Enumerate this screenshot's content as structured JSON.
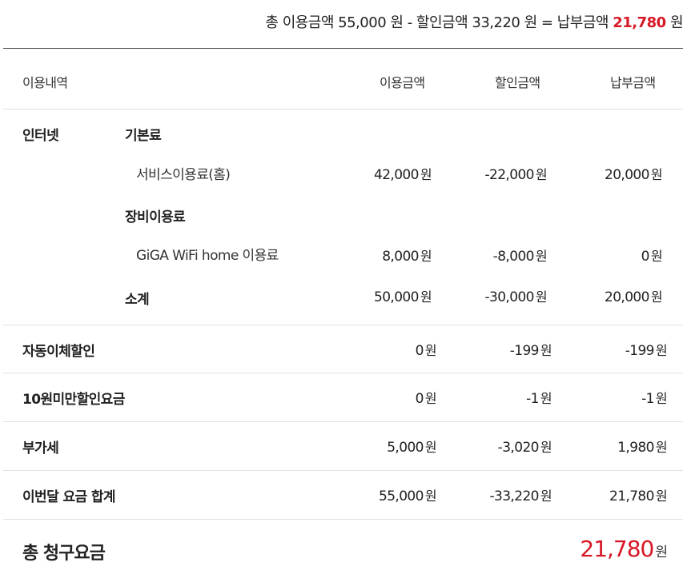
{
  "summary": {
    "usage_label": "총 이용금액",
    "usage_amount": "55,000",
    "minus": "-",
    "discount_label": "할인금액",
    "discount_amount": "33,220",
    "equals": "=",
    "pay_label": "납부금액",
    "pay_amount": "21,780",
    "won": "원"
  },
  "headers": {
    "item": "이용내역",
    "usage": "이용금액",
    "discount": "할인금액",
    "pay": "납부금액"
  },
  "internet": {
    "category": "인터넷",
    "base_fee_label": "기본료",
    "service_fee": {
      "label": "서비스이용료(홈)",
      "usage": "42,000",
      "discount": "-22,000",
      "pay": "20,000"
    },
    "equipment_label": "장비이용료",
    "giga_wifi": {
      "label": "GiGA WiFi home 이용료",
      "usage": "8,000",
      "discount": "-8,000",
      "pay": "0"
    },
    "subtotal": {
      "label": "소계",
      "usage": "50,000",
      "discount": "-30,000",
      "pay": "20,000"
    }
  },
  "rows": [
    {
      "label": "자동이체할인",
      "usage": "0",
      "discount": "-199",
      "pay": "-199"
    },
    {
      "label": "10원미만할인요금",
      "usage": "0",
      "discount": "-1",
      "pay": "-1"
    },
    {
      "label": "부가세",
      "usage": "5,000",
      "discount": "-3,020",
      "pay": "1,980"
    },
    {
      "label": "이번달 요금 합계",
      "usage": "55,000",
      "discount": "-33,220",
      "pay": "21,780"
    }
  ],
  "total": {
    "label": "총 청구요금",
    "amount": "21,780"
  },
  "won": "원",
  "colors": {
    "accent_red": "#d71826"
  }
}
